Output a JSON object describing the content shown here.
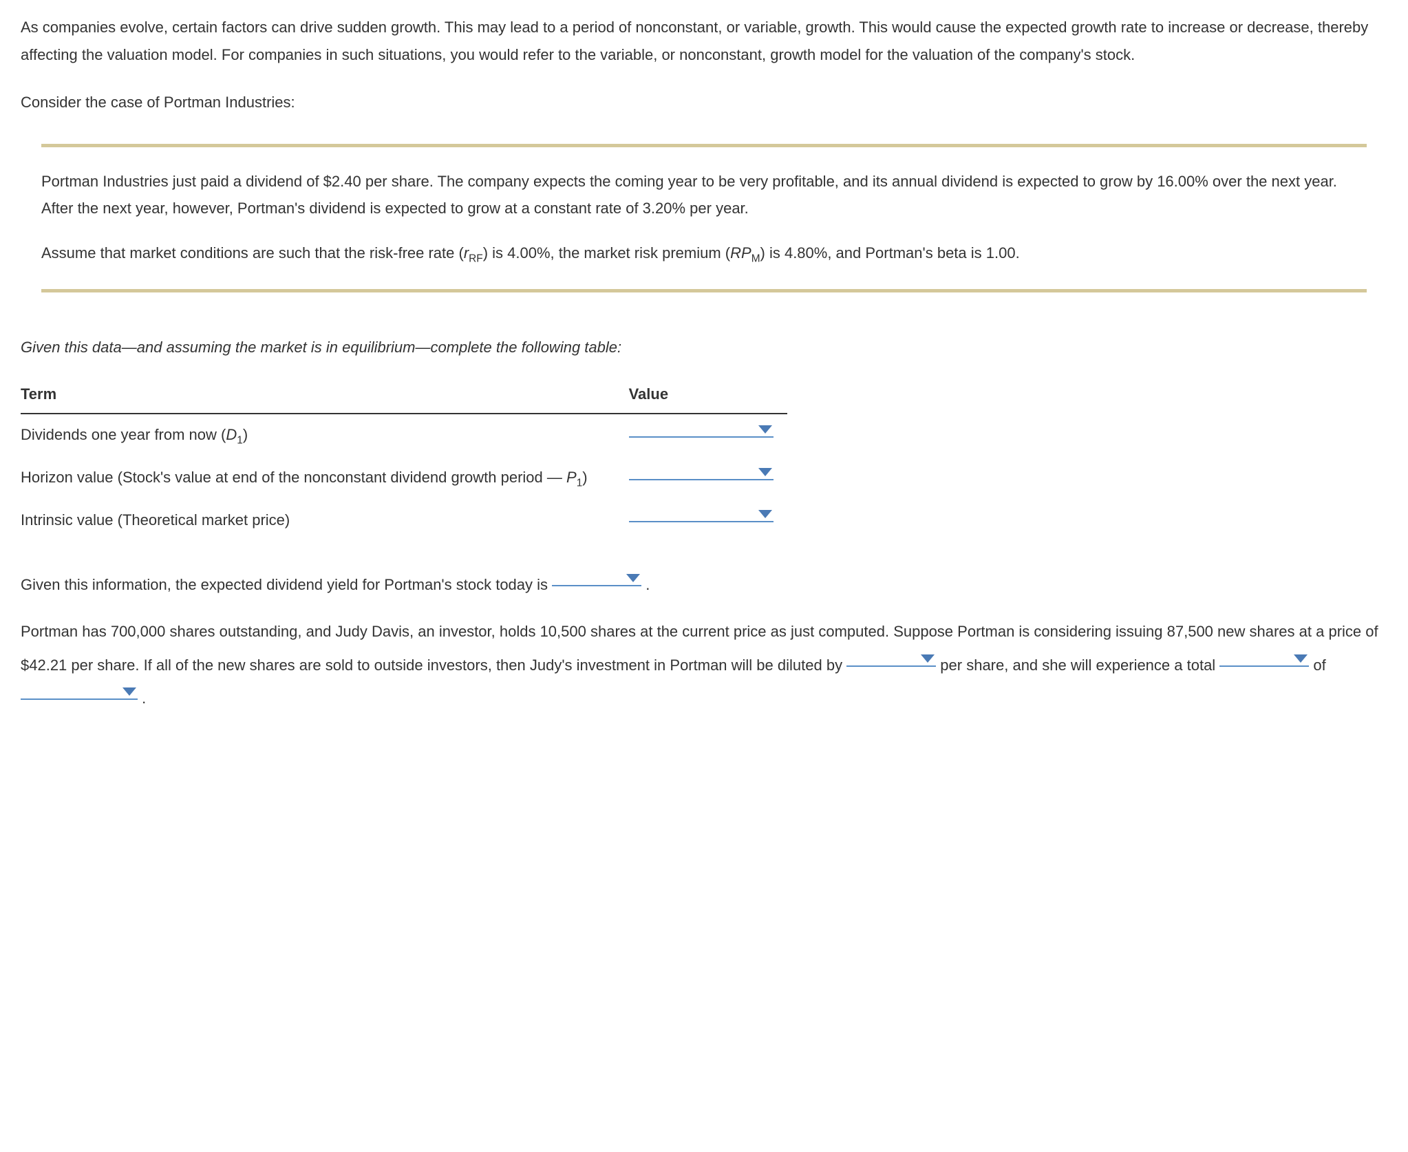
{
  "intro": {
    "text": "As companies evolve, certain factors can drive sudden growth. This may lead to a period of nonconstant, or variable, growth. This would cause the expected growth rate to increase or decrease, thereby affecting the valuation model. For companies in such situations, you would refer to the variable, or nonconstant, growth model for the valuation of the company's stock."
  },
  "case_label": "Consider the case of Portman Industries:",
  "problem": {
    "para1": "Portman Industries just paid a dividend of $2.40 per share. The company expects the coming year to be very profitable, and its annual dividend is expected to grow by 16.00% over the next year. After the next year, however, Portman's dividend is expected to grow at a constant rate of 3.20% per year.",
    "para2_pre": "Assume that market conditions are such that the risk-free rate (",
    "para2_rrf_var": "r",
    "para2_rrf_sub": "RF",
    "para2_mid1": ") is 4.00%, the market risk premium (",
    "para2_rp_var": "RP",
    "para2_rp_sub": "M",
    "para2_post": ") is 4.80%, and Portman's beta is 1.00."
  },
  "table_prompt": "Given this data—and assuming the market is in equilibrium—complete the following table:",
  "table": {
    "header_term": "Term",
    "header_value": "Value",
    "rows": [
      {
        "label_pre": "Dividends one year from now (",
        "label_var": "D",
        "label_sub": "1",
        "label_post": ")"
      },
      {
        "label_pre": "Horizon value (Stock's value at end of the nonconstant dividend growth period — ",
        "label_var": "P",
        "label_sub": "1",
        "label_post": ")"
      },
      {
        "label_pre": "Intrinsic value (Theoretical market price)",
        "label_var": "",
        "label_sub": "",
        "label_post": ""
      }
    ]
  },
  "dividend_yield": {
    "pre": "Given this information, the expected dividend yield for Portman's stock today is ",
    "post": " ."
  },
  "dilution": {
    "pre": "Portman has 700,000 shares outstanding, and Judy Davis, an investor, holds 10,500 shares at the current price as just computed. Suppose Portman is considering issuing 87,500 new shares at a price of $42.21 per share. If all of the new shares are sold to outside investors, then Judy's investment in Portman will be diluted by ",
    "mid1": " per share, and she will experience a total ",
    "mid2": " of ",
    "post": " ."
  }
}
